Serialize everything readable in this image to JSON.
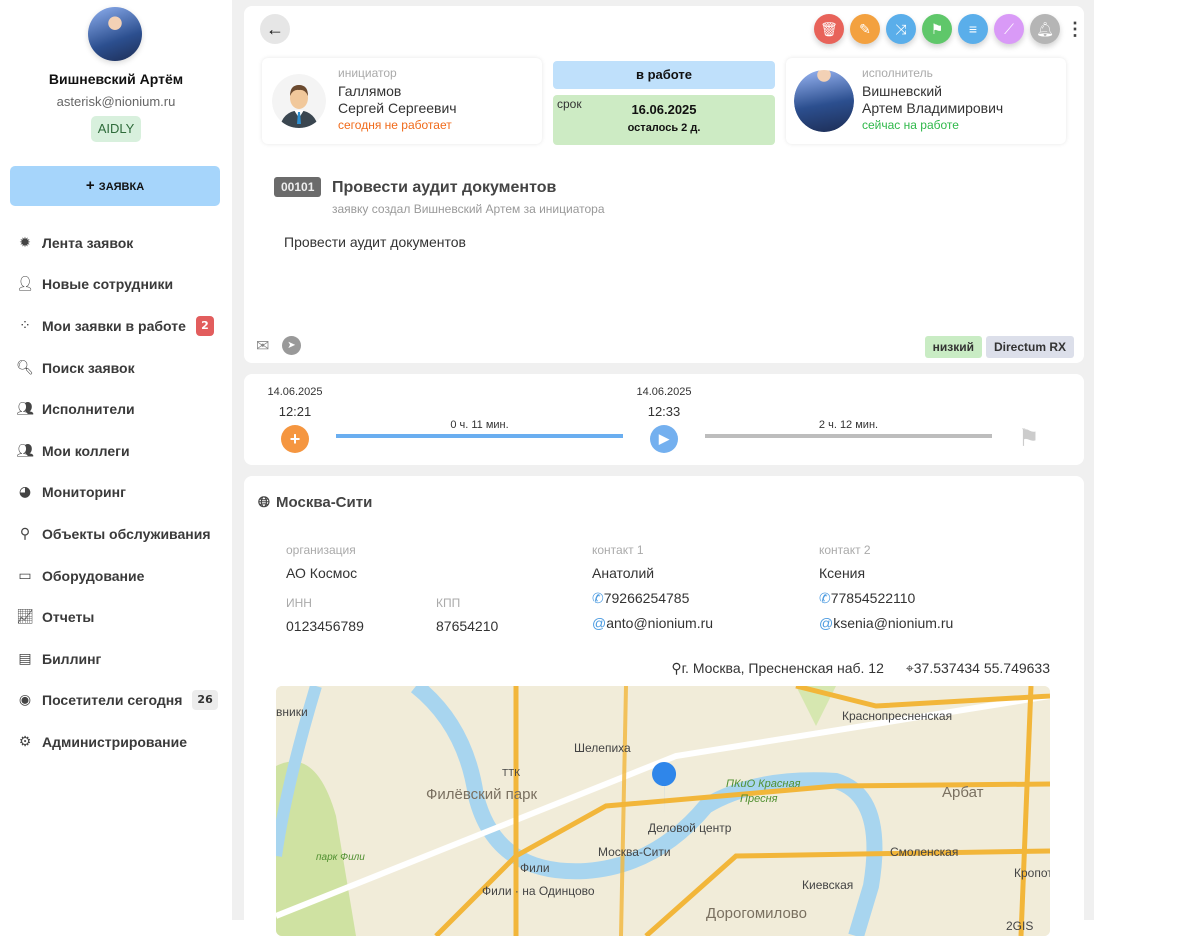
{
  "user": {
    "name": "Вишневский Артём",
    "email": "asterisk@nionium.ru",
    "org_tag": "AIDLY"
  },
  "new_request_label": "ЗАЯВКА",
  "nav": [
    {
      "label": "Лента заявок",
      "icon": "feed-gear-icon"
    },
    {
      "label": "Новые сотрудники",
      "icon": "user-plus-icon"
    },
    {
      "label": "Мои заявки в работе",
      "icon": "spinner-icon",
      "badge": "2"
    },
    {
      "label": "Поиск заявок",
      "icon": "search-icon"
    },
    {
      "label": "Исполнители",
      "icon": "users-icon"
    },
    {
      "label": "Мои коллеги",
      "icon": "colleagues-icon"
    },
    {
      "label": "Мониторинг",
      "icon": "pie-chart-icon"
    },
    {
      "label": "Объекты обслуживания",
      "icon": "map-marker-icon"
    },
    {
      "label": "Оборудование",
      "icon": "laptop-icon"
    },
    {
      "label": "Отчеты",
      "icon": "line-chart-icon"
    },
    {
      "label": "Биллинг",
      "icon": "receipt-icon"
    },
    {
      "label": "Посетители сегодня",
      "icon": "eye-icon",
      "badge": "26"
    },
    {
      "label": "Администрирование",
      "icon": "cog-icon"
    }
  ],
  "actions": [
    {
      "name": "delete",
      "icon": "trash-icon",
      "color": "#e8635a"
    },
    {
      "name": "edit",
      "icon": "pencil-icon",
      "color": "#f3a13f"
    },
    {
      "name": "reassign",
      "icon": "shuffle-icon",
      "color": "#5aaeea"
    },
    {
      "name": "finish",
      "icon": "flag-checkered-icon",
      "color": "#5fc76a"
    },
    {
      "name": "list",
      "icon": "list-icon",
      "color": "#5aaeea"
    },
    {
      "name": "stats",
      "icon": "chart-icon",
      "color": "#d99af7"
    },
    {
      "name": "notify",
      "icon": "bell-icon",
      "color": "#b5b5b5"
    }
  ],
  "initiator": {
    "role": "инициатор",
    "last_name": "Галлямов",
    "first_names": "Сергей Сергеевич",
    "status": "сегодня не работает",
    "status_color": "#f06a1a"
  },
  "executor": {
    "role": "исполнитель",
    "last_name": "Вишневский",
    "first_names": "Артем Владимирович",
    "status": "сейчас на работе",
    "status_color": "#2fb84a"
  },
  "state": "в работе",
  "deadline": {
    "label": "срок",
    "date": "16.06.2025",
    "remaining": "осталось 2 д."
  },
  "request": {
    "number": "00101",
    "title": "Провести аудит документов",
    "created_by": "заявку создал Вишневский Артем за инициатора",
    "description": "Провести аудит документов",
    "priority": "низкий",
    "system": "Directum RX"
  },
  "timeline": {
    "created": {
      "date": "14.06.2025",
      "time": "12:21"
    },
    "started": {
      "date": "14.06.2025",
      "time": "12:33"
    },
    "dur1": "0 ч. 11 мин.",
    "dur2": "2 ч. 12 мин."
  },
  "location": {
    "name": "Москва-Сити",
    "org_label": "организация",
    "org": "АО Космос",
    "inn_label": "ИНН",
    "inn": "0123456789",
    "kpp_label": "КПП",
    "kpp": "87654210",
    "contact1": {
      "label": "контакт 1",
      "name": "Анатолий",
      "phone": "79266254785",
      "email": "anto@nionium.ru"
    },
    "contact2": {
      "label": "контакт 2",
      "name": "Ксения",
      "phone": "77854522110",
      "email": "ksenia@nionium.ru"
    },
    "address": "г. Москва, Пресненская наб. 12",
    "coords": "37.537434 55.749633"
  },
  "map": {
    "labels": [
      "Филёвский парк",
      "парк Фили",
      "Шелепиха",
      "Деловой центр",
      "Москва-Сити",
      "Фили",
      "Фили · на Одинцово",
      "ПКиО Красная",
      "Пресня",
      "Краснопресненская",
      "Арбат",
      "Смоленская",
      "Киевская",
      "Дорогомилово",
      "вники",
      "Кропотки",
      "ТТК",
      "2GIS"
    ]
  }
}
